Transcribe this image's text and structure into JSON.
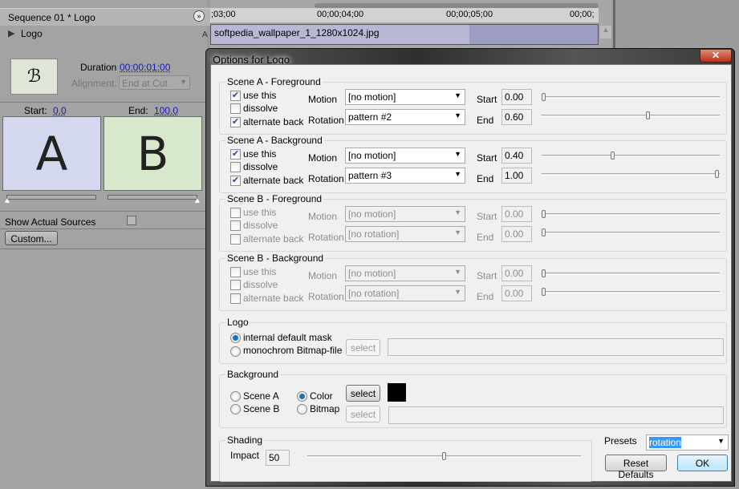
{
  "left_panel": {
    "tab_title": "Sequence 01 * Logo",
    "track_name": "Logo",
    "duration_label": "Duration",
    "duration_value": "00:00:01:00",
    "alignment_label": "Alignment:",
    "alignment_value": "End at Cut",
    "start_label": "Start:",
    "start_value": "0.0",
    "end_label": "End:",
    "end_value": "100.0",
    "thumb_a": "A",
    "thumb_b": "B",
    "show_sources_label": "Show Actual Sources",
    "show_sources_checked": false,
    "custom_button": "Custom...",
    "track_letter_a": "A"
  },
  "timeline": {
    "ticks": [
      ";03;00",
      "00;00;04;00",
      "00;00;05;00",
      "00;00;"
    ],
    "clip_name": "softpedia_wallpaper_1_1280x1024.jpg"
  },
  "dialog": {
    "title": "Options for Logo",
    "close_icon": "close-icon",
    "labels": {
      "motion": "Motion",
      "rotation": "Rotation",
      "start": "Start",
      "end": "End",
      "use_this": "use this",
      "dissolve": "dissolve",
      "alternate_back": "alternate back"
    },
    "scenes": [
      {
        "title": "Scene A - Foreground",
        "enabled": true,
        "use_this": true,
        "dissolve": false,
        "alternate_back": true,
        "motion": "[no motion]",
        "rotation": "pattern #2",
        "start": "0.00",
        "end": "0.60"
      },
      {
        "title": "Scene A - Background",
        "enabled": true,
        "use_this": true,
        "dissolve": false,
        "alternate_back": true,
        "motion": "[no motion]",
        "rotation": "pattern #3",
        "start": "0.40",
        "end": "1.00"
      },
      {
        "title": "Scene B - Foreground",
        "enabled": false,
        "use_this": false,
        "dissolve": false,
        "alternate_back": false,
        "motion": "[no motion]",
        "rotation": "[no rotation]",
        "start": "0.00",
        "end": "0.00"
      },
      {
        "title": "Scene B - Background",
        "enabled": false,
        "use_this": false,
        "dissolve": false,
        "alternate_back": false,
        "motion": "[no motion]",
        "rotation": "[no rotation]",
        "start": "0.00",
        "end": "0.00"
      }
    ],
    "logo": {
      "title": "Logo",
      "opt_internal": "internal default mask",
      "opt_bitmap": "monochrom Bitmap-file",
      "selected": "internal",
      "select_button": "select"
    },
    "background": {
      "title": "Background",
      "scene_a": "Scene A",
      "scene_b": "Scene B",
      "color": "Color",
      "bitmap": "Bitmap",
      "selected": "Color",
      "select_color_button": "select",
      "select_bitmap_button": "select",
      "color_value": "#000000"
    },
    "shading": {
      "title": "Shading",
      "impact_label": "Impact",
      "impact_value": "50",
      "impact_percent": 50
    },
    "presets": {
      "label": "Presets",
      "value": "rotation"
    },
    "reset_button": "Reset Defaults",
    "ok_button": "OK"
  }
}
